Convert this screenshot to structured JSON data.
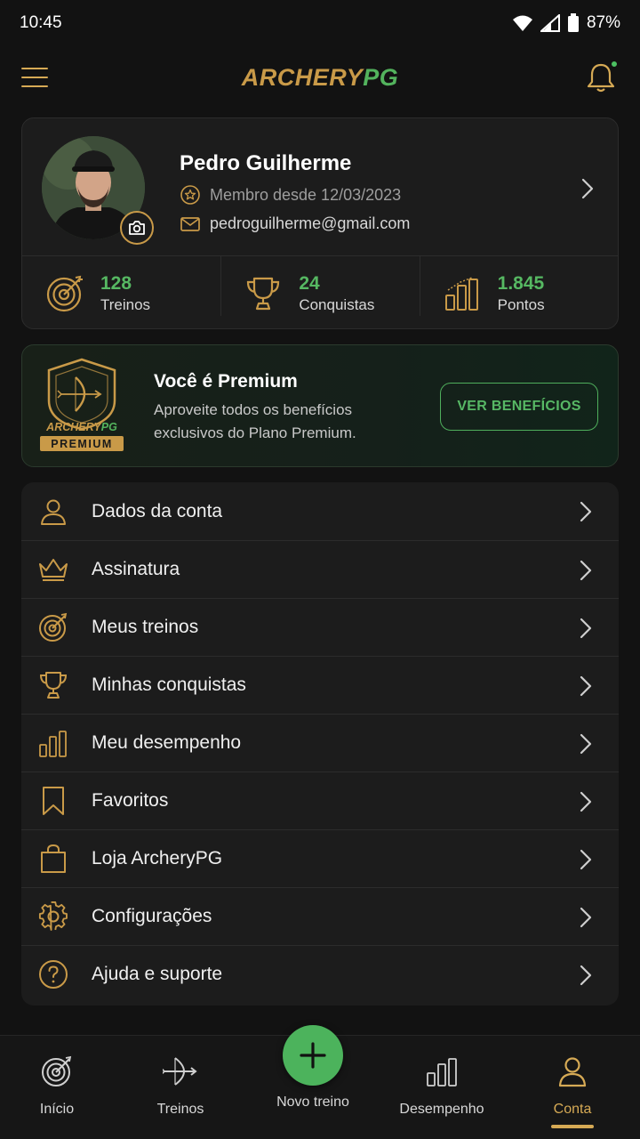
{
  "status_bar": {
    "time": "10:45",
    "battery": "87%"
  },
  "header": {
    "logo_part1": "ARCHERY",
    "logo_part2": "PG"
  },
  "profile": {
    "name": "Pedro Guilherme",
    "member_since": "Membro desde 12/03/2023",
    "email": "pedroguilherme@gmail.com",
    "stats": [
      {
        "value": "128",
        "label": "Treinos",
        "icon": "target-icon"
      },
      {
        "value": "24",
        "label": "Conquistas",
        "icon": "trophy-icon"
      },
      {
        "value": "1.845",
        "label": "Pontos",
        "icon": "bars-icon"
      }
    ]
  },
  "premium": {
    "badge_brand_a": "ARCHERY",
    "badge_brand_b": "PG",
    "badge_label": "PREMIUM",
    "title": "Você é Premium",
    "description": "Aproveite todos os benefícios exclusivos do Plano Premium.",
    "button": "VER BENEFÍCIOS"
  },
  "menu": {
    "items": [
      {
        "label": "Dados da conta",
        "icon": "user-icon"
      },
      {
        "label": "Assinatura",
        "icon": "crown-icon"
      },
      {
        "label": "Meus treinos",
        "icon": "target-icon"
      },
      {
        "label": "Minhas conquistas",
        "icon": "trophy-icon"
      },
      {
        "label": "Meu desempenho",
        "icon": "bars-icon"
      },
      {
        "label": "Favoritos",
        "icon": "bookmark-icon"
      },
      {
        "label": "Loja ArcheryPG",
        "icon": "shopping-bag-icon"
      },
      {
        "label": "Configurações",
        "icon": "gear-icon"
      },
      {
        "label": "Ajuda e suporte",
        "icon": "help-icon"
      }
    ]
  },
  "bottom_nav": {
    "items": [
      {
        "label": "Início",
        "icon": "target-icon"
      },
      {
        "label": "Treinos",
        "icon": "bow-icon"
      },
      {
        "label": "Novo treino",
        "icon": "plus-icon"
      },
      {
        "label": "Desempenho",
        "icon": "bars-icon"
      },
      {
        "label": "Conta",
        "icon": "user-icon"
      }
    ],
    "active": "Conta"
  },
  "colors": {
    "gold": "#d6aa55",
    "green": "#56b862",
    "background": "#121212",
    "card": "#1c1c1c"
  }
}
